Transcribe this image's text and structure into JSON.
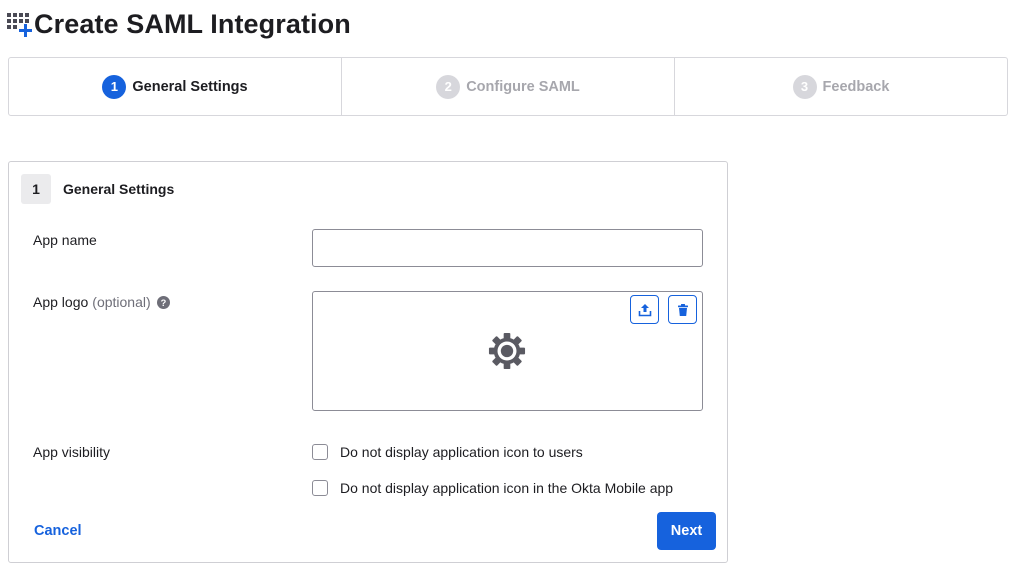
{
  "page": {
    "title": "Create SAML Integration",
    "icon": "app-grid-add-icon"
  },
  "stepper": {
    "steps": [
      {
        "number": "1",
        "label": "General Settings",
        "state": "active"
      },
      {
        "number": "2",
        "label": "Configure SAML",
        "state": "inactive"
      },
      {
        "number": "3",
        "label": "Feedback",
        "state": "inactive"
      }
    ]
  },
  "section": {
    "number": "1",
    "title": "General Settings"
  },
  "form": {
    "app_name": {
      "label": "App name",
      "value": "",
      "placeholder": ""
    },
    "app_logo": {
      "label": "App logo",
      "optional_text": "(optional)",
      "help_icon": "question-circle-icon",
      "placeholder_icon": "gear-icon",
      "upload_icon": "upload-icon",
      "delete_icon": "trash-icon"
    },
    "app_visibility": {
      "label": "App visibility",
      "options": [
        {
          "label": "Do not display application icon to users",
          "checked": false
        },
        {
          "label": "Do not display application icon in the Okta Mobile app",
          "checked": false
        }
      ]
    }
  },
  "actions": {
    "cancel_label": "Cancel",
    "next_label": "Next"
  },
  "colors": {
    "primary": "#1662dd",
    "border": "#d7d7dc",
    "text": "#1d1d21",
    "muted": "#a7a7ad"
  }
}
